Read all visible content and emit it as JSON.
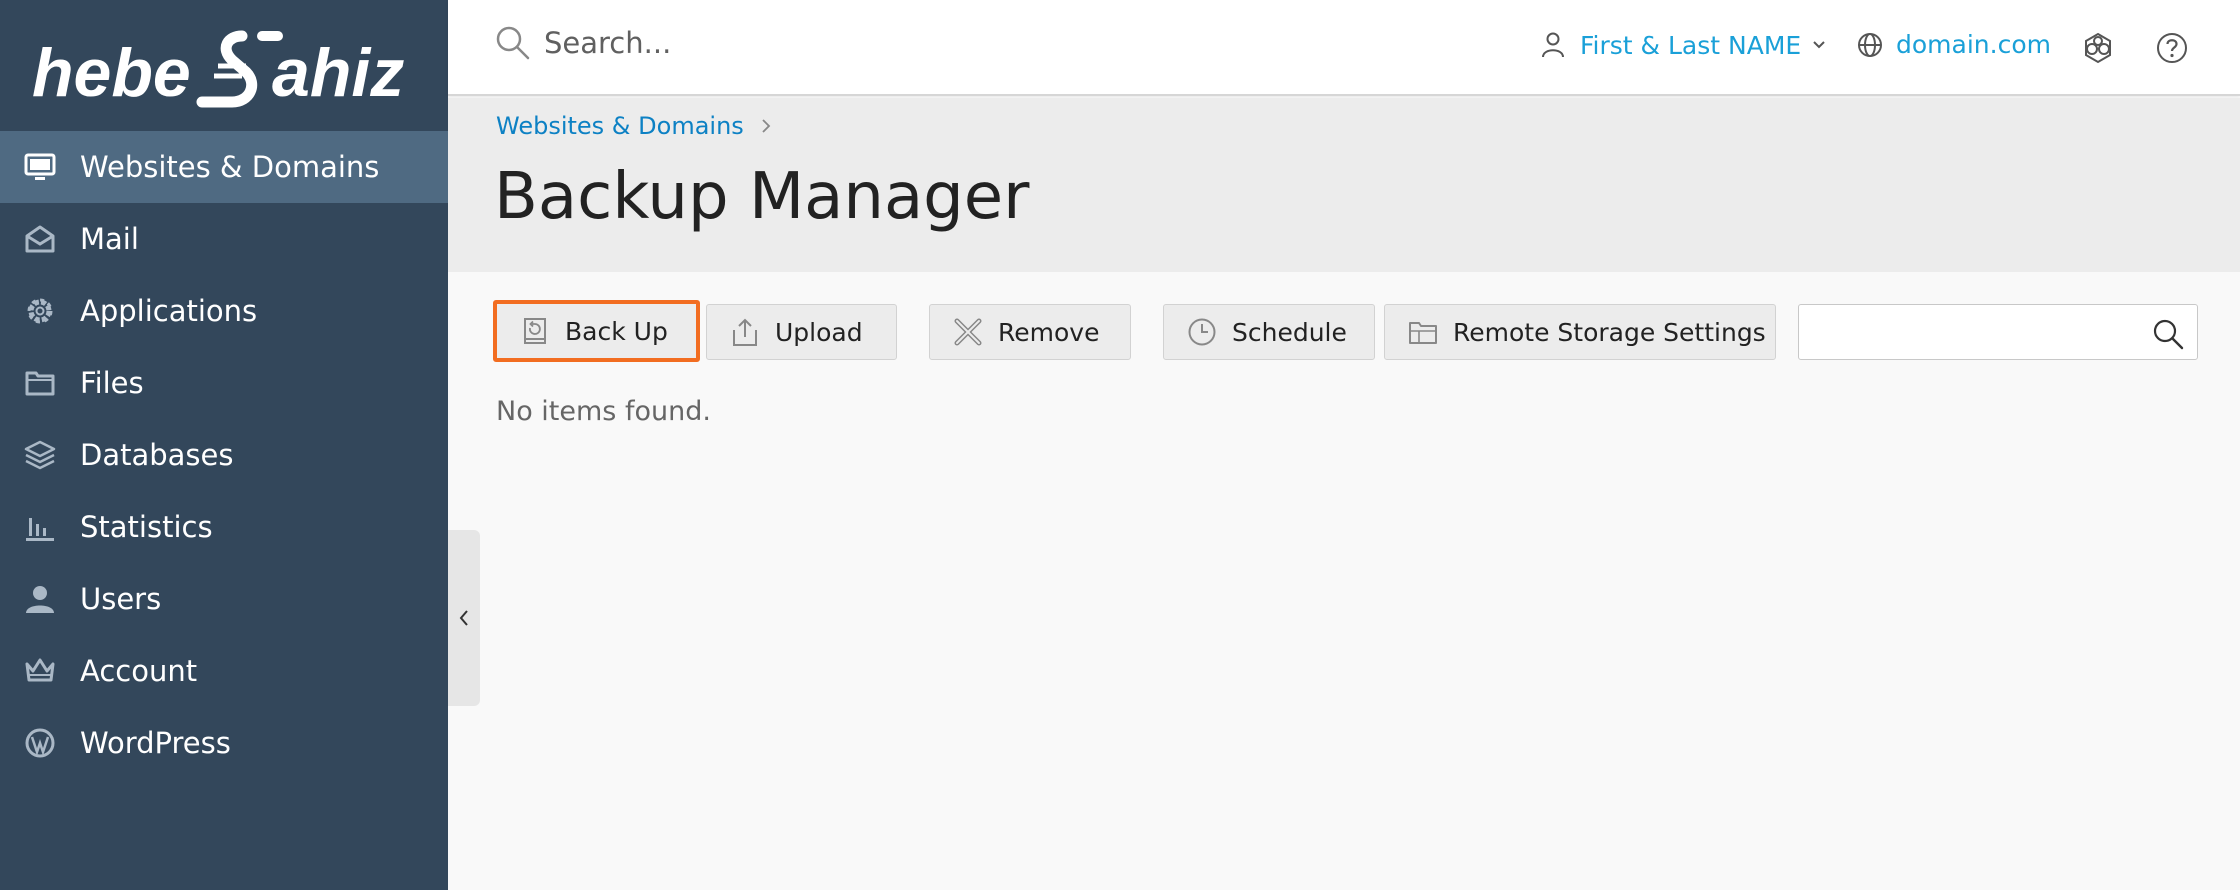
{
  "brand": {
    "logo_text": "hebe Şahiz"
  },
  "sidebar": {
    "items": [
      {
        "label": "Websites & Domains",
        "icon": "monitor-icon",
        "active": true
      },
      {
        "label": "Mail",
        "icon": "mail-icon"
      },
      {
        "label": "Applications",
        "icon": "gear-icon"
      },
      {
        "label": "Files",
        "icon": "folder-icon"
      },
      {
        "label": "Databases",
        "icon": "layers-icon"
      },
      {
        "label": "Statistics",
        "icon": "bar-chart-icon"
      },
      {
        "label": "Users",
        "icon": "user-icon"
      },
      {
        "label": "Account",
        "icon": "crown-icon"
      },
      {
        "label": "WordPress",
        "icon": "wordpress-icon"
      }
    ]
  },
  "header": {
    "search_placeholder": "Search...",
    "user_name": "First & Last NAME",
    "domain": "domain.com",
    "icons": [
      "extensions-icon",
      "help-icon"
    ]
  },
  "page": {
    "breadcrumb": "Websites & Domains",
    "title": "Backup Manager"
  },
  "toolbar": {
    "backup_label": "Back Up",
    "upload_label": "Upload",
    "remove_label": "Remove",
    "schedule_label": "Schedule",
    "remote_label": "Remote Storage Settings"
  },
  "list": {
    "search_value": "",
    "empty_message": "No items found."
  },
  "colors": {
    "sidebar_bg": "#33475b",
    "sidebar_active": "#4f6a82",
    "link": "#1aa0d8",
    "highlight": "#f26d21"
  }
}
